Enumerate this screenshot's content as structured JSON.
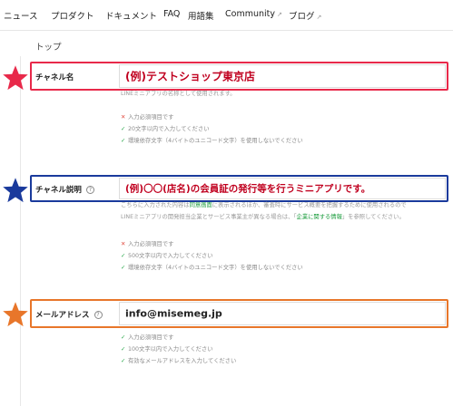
{
  "nav": {
    "items": [
      "ニュース",
      "プロダクト",
      "ドキュメント",
      "FAQ",
      "用語集",
      "Community",
      "ブログ"
    ],
    "external_icon": "↗"
  },
  "breadcrumb": "トップ",
  "colors": {
    "red": "#e8294a",
    "blue": "#1a3a9c",
    "orange": "#e8762a",
    "accent_text": "#c0001f"
  },
  "channel_name": {
    "label": "チャネル名",
    "value": "(例)テストショップ東京店",
    "description": "LINEミニアプリの名称として使用されます。",
    "rules": [
      "入力必須項目です",
      "20文字以内で入力してください",
      "環境依存文字（4バイトのユニコード文字）を使用しないでください"
    ]
  },
  "channel_description": {
    "label": "チャネル説明",
    "help_icon": "?",
    "value": "(例)〇〇(店名)の会員証の発行等を行うミニアプリです。",
    "description": {
      "part1": "こちらに入力された内容は",
      "link1": "同意画面",
      "part2": "に表示されるほか、審査時にサービス概要を把握するために使用されるので",
      "line2_part1": "LINEミニアプリの開発担当企業とサービス事業主が異なる場合は、「",
      "link2": "企業に関する情報",
      "line2_part2": "」を参照してください。"
    },
    "rules": [
      "入力必須項目です",
      "500文字以内で入力してください",
      "環境依存文字（4バイトのユニコード文字）を使用しないでください"
    ]
  },
  "email": {
    "label": "メールアドレス",
    "help_icon": "?",
    "value": "info@misemeg.jp",
    "rules": [
      "入力必須項目です",
      "100文字以内で入力してください",
      "有効なメールアドレスを入力してください"
    ]
  },
  "rule_marks": {
    "error": "✕",
    "ok": "✓"
  }
}
